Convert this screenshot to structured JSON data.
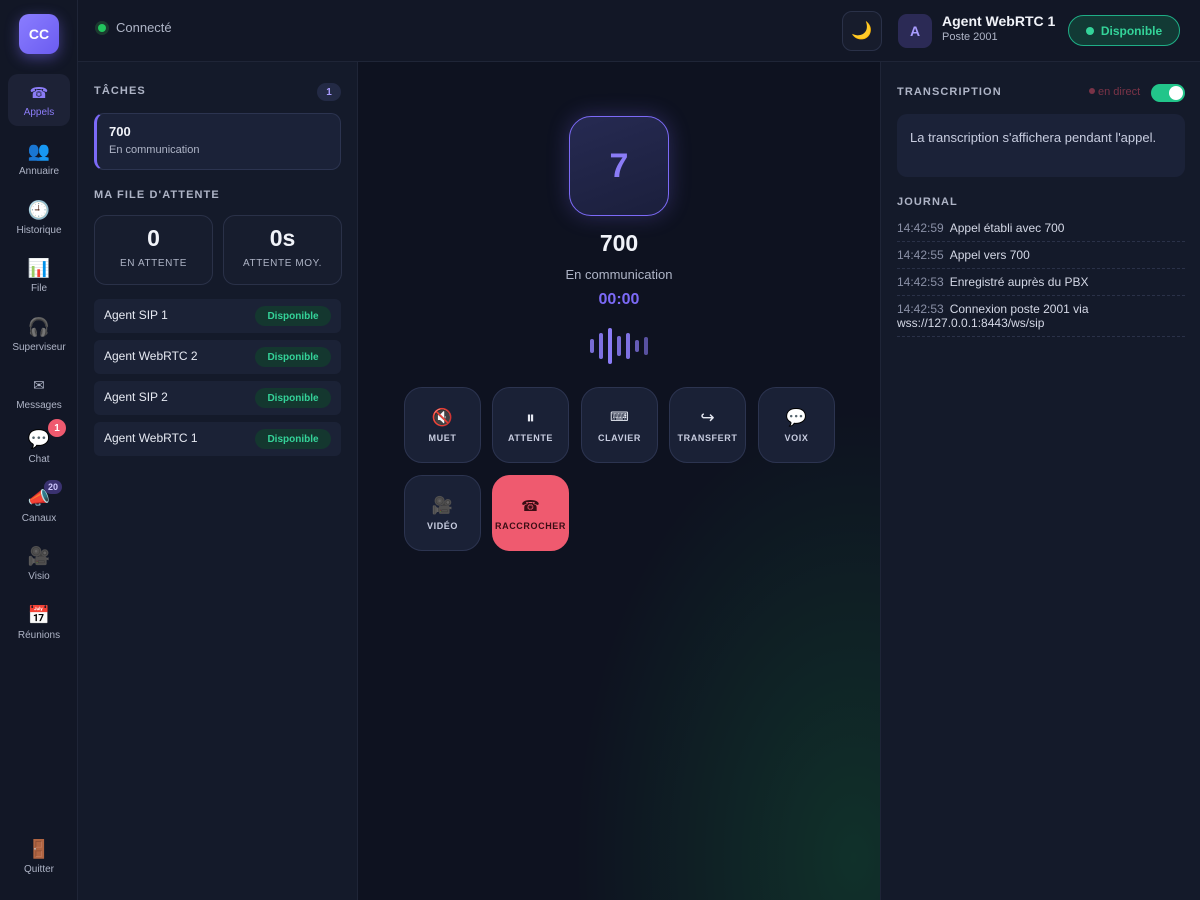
{
  "app": {
    "logo": "CC"
  },
  "sidebar": {
    "items": [
      {
        "label": "Appels",
        "icon": "phone-icon",
        "glyph": "☎",
        "active": true
      },
      {
        "label": "Annuaire",
        "icon": "users-icon",
        "glyph": "👥"
      },
      {
        "label": "Historique",
        "icon": "clock-icon",
        "glyph": "🕘"
      },
      {
        "label": "File",
        "icon": "chart-icon",
        "glyph": "📊"
      },
      {
        "label": "Superviseur",
        "icon": "headset-icon",
        "glyph": "🎧"
      },
      {
        "label": "Messages",
        "icon": "envelope-icon",
        "glyph": "✉"
      },
      {
        "label": "Chat",
        "icon": "chat-bubble-icon",
        "glyph": "💬",
        "badge": "1"
      },
      {
        "label": "Canaux",
        "icon": "megaphone-icon",
        "glyph": "📣",
        "badge": "20"
      },
      {
        "label": "Visio",
        "icon": "video-camera-icon",
        "glyph": "🎥"
      },
      {
        "label": "Réunions",
        "icon": "calendar-icon",
        "glyph": "📅"
      }
    ],
    "quit": {
      "label": "Quitter",
      "icon": "door-icon",
      "glyph": "🚪"
    }
  },
  "topbar": {
    "connection": "Connecté",
    "theme_icon": "moon-icon",
    "theme_glyph": "🌙",
    "agent_initial": "A",
    "agent_name": "Agent WebRTC 1",
    "agent_post": "Poste 2001",
    "status": "Disponible"
  },
  "tasks": {
    "title": "TÂCHES",
    "count": "1",
    "items": [
      {
        "number": "700",
        "status": "En communication"
      }
    ]
  },
  "queue": {
    "title": "MA FILE D'ATTENTE",
    "stats": [
      {
        "value": "0",
        "label": "EN ATTENTE"
      },
      {
        "value": "0s",
        "label": "ATTENTE MOY."
      }
    ],
    "agents": [
      {
        "name": "Agent SIP 1",
        "status": "Disponible"
      },
      {
        "name": "Agent WebRTC 2",
        "status": "Disponible"
      },
      {
        "name": "Agent SIP 2",
        "status": "Disponible"
      },
      {
        "name": "Agent WebRTC 1",
        "status": "Disponible"
      }
    ]
  },
  "call": {
    "avatar": "7",
    "number": "700",
    "status": "En communication",
    "timer": "00:00",
    "actions": [
      {
        "label": "MUET",
        "icon": "mute-icon",
        "glyph": "🔇"
      },
      {
        "label": "ATTENTE",
        "icon": "pause-icon",
        "glyph": "⏸"
      },
      {
        "label": "CLAVIER",
        "icon": "keyboard-icon",
        "glyph": "⌨"
      },
      {
        "label": "TRANSFERT",
        "icon": "transfer-icon",
        "glyph": "↪"
      },
      {
        "label": "VOIX",
        "icon": "speech-bubble-icon",
        "glyph": "💬"
      },
      {
        "label": "VIDÉO",
        "icon": "video-camera-icon",
        "glyph": "🎥"
      },
      {
        "label": "RACCROCHER",
        "icon": "hang-up-icon",
        "glyph": "☎",
        "danger": true
      }
    ]
  },
  "transcription": {
    "title": "TRANSCRIPTION",
    "live_label": "en direct",
    "enabled": true,
    "placeholder": "La transcription s'affichera pendant l'appel."
  },
  "journal": {
    "title": "JOURNAL",
    "entries": [
      {
        "time": "14:42:59",
        "text": "Appel établi avec 700"
      },
      {
        "time": "14:42:55",
        "text": "Appel vers 700"
      },
      {
        "time": "14:42:53",
        "text": "Enregistré auprès du PBX"
      },
      {
        "time": "14:42:53",
        "text": "Connexion poste 2001 via wss://127.0.0.1:8443/ws/sip"
      }
    ]
  },
  "colors": {
    "accent": "#7c6af7",
    "success": "#34d399",
    "danger": "#ef5a6f",
    "background": "#0f1320"
  }
}
